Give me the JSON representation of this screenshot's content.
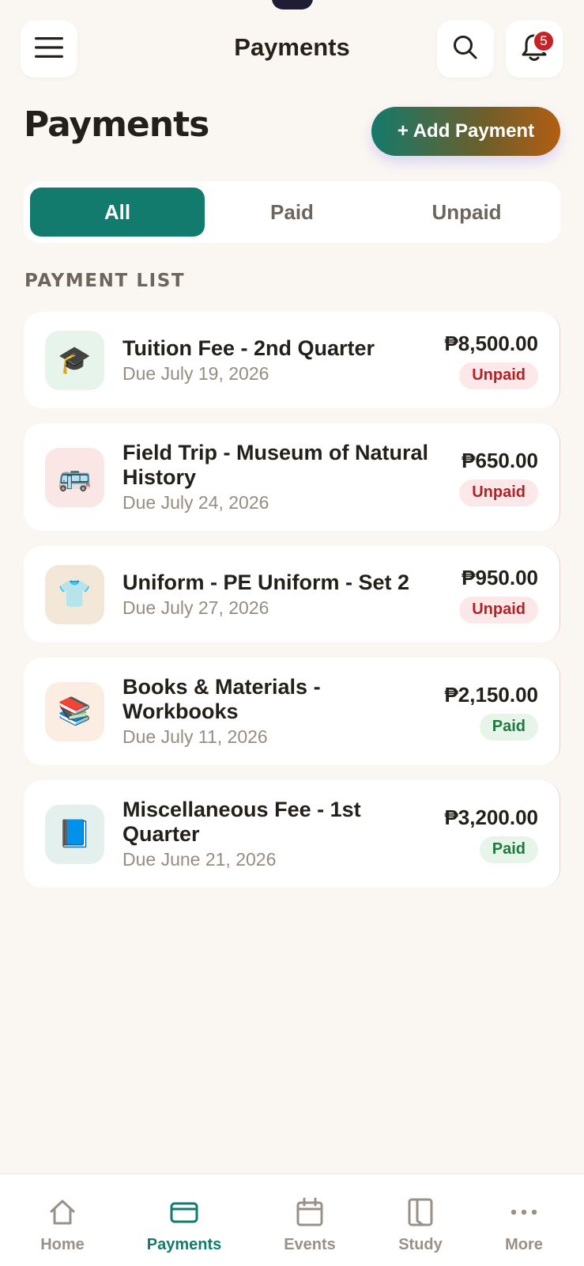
{
  "header": {
    "title": "Payments",
    "notification_count": "5"
  },
  "page": {
    "title": "Payments",
    "add_button_label": "+ Add Payment"
  },
  "filters": {
    "tabs": [
      {
        "label": "All",
        "active": true
      },
      {
        "label": "Paid",
        "active": false
      },
      {
        "label": "Unpaid",
        "active": false
      }
    ]
  },
  "section_label": "PAYMENT LIST",
  "payments": [
    {
      "icon": "graduation-cap-icon",
      "emoji": "🎓",
      "icon_bg": "#E7F4EC",
      "title": "Tuition Fee - 2nd Quarter",
      "due": "Due July 19, 2026",
      "amount": "₱8,500.00",
      "status": "Unpaid"
    },
    {
      "icon": "bus-icon",
      "emoji": "🚌",
      "icon_bg": "#FBE6E6",
      "title": "Field Trip - Museum of Natural History",
      "due": "Due July 24, 2026",
      "amount": "₱650.00",
      "status": "Unpaid"
    },
    {
      "icon": "tshirt-icon",
      "emoji": "👕",
      "icon_bg": "#F3E8D8",
      "title": "Uniform - PE Uniform - Set 2",
      "due": "Due July 27, 2026",
      "amount": "₱950.00",
      "status": "Unpaid"
    },
    {
      "icon": "books-icon",
      "emoji": "📚",
      "icon_bg": "#FCEDE2",
      "title": "Books & Materials - Workbooks",
      "due": "Due July 11, 2026",
      "amount": "₱2,150.00",
      "status": "Paid"
    },
    {
      "icon": "blue-book-icon",
      "emoji": "📘",
      "icon_bg": "#E4F0EE",
      "title": "Miscellaneous Fee - 1st Quarter",
      "due": "Due June 21, 2026",
      "amount": "₱3,200.00",
      "status": "Paid"
    }
  ],
  "bottom_nav": [
    {
      "label": "Home",
      "icon": "home-icon",
      "active": false
    },
    {
      "label": "Payments",
      "icon": "credit-card-icon",
      "active": true
    },
    {
      "label": "Events",
      "icon": "calendar-icon",
      "active": false
    },
    {
      "label": "Study",
      "icon": "book-open-icon",
      "active": false
    },
    {
      "label": "More",
      "icon": "more-dots-icon",
      "active": false
    }
  ],
  "colors": {
    "background": "#FAF7F2",
    "primary": "#137A6E",
    "unpaid": "#B32226",
    "paid": "#1F7A3D",
    "badge": "#C62328"
  }
}
